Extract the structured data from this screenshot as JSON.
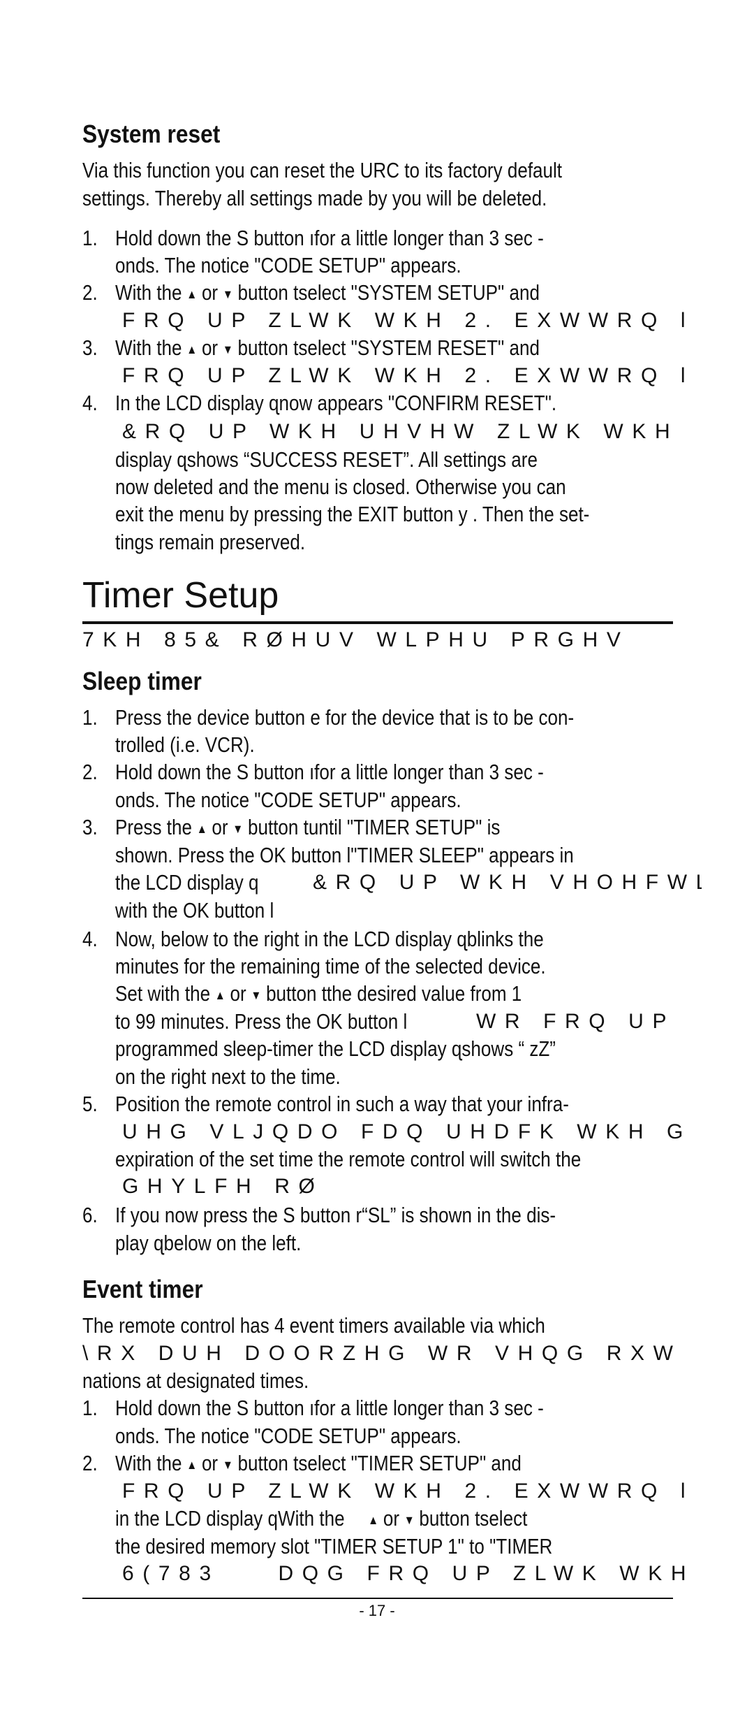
{
  "system_reset": {
    "heading": "System reset",
    "intro": [
      "Via this function you can reset the URC to its factory default",
      "settings. Thereby all settings made by you will be deleted."
    ],
    "s1n": "1.",
    "s1a": "Hold down the S button ıfor a little longer than 3 sec   -",
    "s1b": "onds. The notice \"CODE SETUP\" appears.",
    "s2n": "2.",
    "s2a": "With the",
    "s2or": "or",
    "s2c": "button tselect \"SYSTEM SETUP\" and",
    "s2g": "FRQ UP ZLWK WKH 2. EXWWRQ l",
    "s3n": "3.",
    "s3a": "With the",
    "s3or": "or",
    "s3c": "button tselect \"SYSTEM RESET\" and",
    "s3g": "FRQ UP ZLWK WKH 2. EXWWRQ l",
    "s4n": "4.",
    "s4a": "In the LCD display ɋnow appears \"CONFIRM RESET\".",
    "s4g": "&RQ UP WKH UHVHW ZLWK WKH",
    "s4b": "display ɋshows “SUCCESS RESET”. All settings are",
    "s4c": "now deleted and the menu is closed. Otherwise you can",
    "s4d": "exit the menu by pressing the EXIT button y  . Then the set-",
    "s4e": "tings remain preserved."
  },
  "timer_setup": {
    "title": "Timer Setup",
    "subtitle_garbled": "7KH 85& RØHUV   WLPHU PRGHV",
    "sleep": {
      "heading": "Sleep timer",
      "s1n": "1.",
      "s1a": "Press the device button e for the device that is to be con-",
      "s1b": "trolled (i.e. VCR).",
      "s2n": "2.",
      "s2a": "Hold down the S button ıfor a little longer than 3 sec   -",
      "s2b": "onds. The notice \"CODE SETUP\" appears.",
      "s3n": "3.",
      "s3a": "Press the",
      "s3or": "or",
      "s3c": "button tuntil \"TIMER SETUP\" is",
      "s3d": "shown. Press the OK button l\"TIMER SLEEP\" appears in",
      "s3e": "the LCD display q",
      "s3g": "&RQ UP WKH VHOHFWL",
      "s3f": "with the OK button l",
      "s4n": "4.",
      "s4a": "Now, below to the right in the LCD display ɋblinks the",
      "s4b": "minutes for the remaining time of the selected device.",
      "s4c1": "Set with the",
      "s4or": "or",
      "s4c2": "button tthe desired value from 1",
      "s4d": "to 99 minutes. Press the OK button l",
      "s4g": "WR FRQ UP",
      "s4e": "programmed sleep-timer the LCD display ɋshows “   zZ”",
      "s4f": "on the right next to the time.",
      "s5n": "5.",
      "s5a": "Position the remote control in such a way that your infra-",
      "s5g": "UHG VLJQDO FDQ UHDFK WKH G",
      "s5b": "expiration of the set time the remote control will switch the",
      "s5g2": "GHYLFH RØ",
      "s6n": "6.",
      "s6a": "If you now press the S button r“SL” is shown in the dis-",
      "s6b": "play ɋbelow on the left."
    },
    "event": {
      "heading": "Event timer",
      "intro_a": "The remote control has 4 event timers available via which",
      "intro_g": "\\RX DUH DOORZHG WR VHQG RXW",
      "intro_b": "nations at designated times.",
      "s1n": "1.",
      "s1a": "Hold down the S button ıfor a little longer than 3 sec   -",
      "s1b": "onds. The notice \"CODE SETUP\" appears.",
      "s2n": "2.",
      "s2a": "With the",
      "s2or": "or",
      "s2c": "button tselect \"TIMER SETUP\" and",
      "s2g": "FRQ UP ZLWK WKH 2. EXWWRQ l",
      "s2d": "in the LCD display qWith the",
      "s2or2": "or",
      "s2e": "button tselect",
      "s2f": "the desired memory slot \"TIMER SETUP 1\" to \"TIMER",
      "s2g2": "6(783    DQG FRQ UP ZLWK WKH"
    }
  },
  "icons": {
    "up": "▲",
    "down": "▼"
  },
  "page_number": "- 17 -"
}
